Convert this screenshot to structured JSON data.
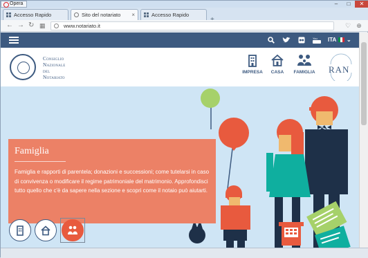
{
  "window": {
    "app_button": "Opera",
    "controls": [
      "–",
      "□",
      "✕"
    ]
  },
  "tabs": [
    {
      "label": "Accesso Rapido",
      "icon": "speed-dial-icon",
      "active": false
    },
    {
      "label": "Sito del notariato",
      "icon": "site-icon",
      "active": true
    },
    {
      "label": "Accesso Rapido",
      "icon": "speed-dial-icon",
      "active": false
    }
  ],
  "addressbar": {
    "url": "www.notariato.it"
  },
  "topbar": {
    "icons": [
      "search-icon",
      "twitter-icon",
      "flickr-icon",
      "youtube-icon"
    ],
    "language": "ITA",
    "language_caret": "⌄",
    "flag_colors": [
      "#009246",
      "#ffffff",
      "#ce2b37"
    ]
  },
  "header": {
    "org_line1": "Consiglio",
    "org_line2": "Nazionale",
    "org_line3": "del",
    "org_line4": "Notariato",
    "nav": [
      {
        "label": "IMPRESA",
        "icon": "building-icon"
      },
      {
        "label": "CASA",
        "icon": "house-icon"
      },
      {
        "label": "FAMIGLIA",
        "icon": "family-icon"
      }
    ],
    "ran_text": "RAN",
    "ran_arc": "RETE ASTE NOTARILI"
  },
  "hero": {
    "title": "Famiglia",
    "body": "Famiglia e rapporti di parentela; donazioni e successioni; come tutelarsi in caso di convivenza o modificare il regime patrimoniale del matrimonio. Approfondisci tutto quello che c'è da sapere nella sezione e scopri come il notaio può aiutarti.",
    "selectors": [
      {
        "icon": "building-icon",
        "active": false
      },
      {
        "icon": "house-icon",
        "active": false
      },
      {
        "icon": "family-icon",
        "active": true
      }
    ],
    "colors": {
      "card": "#ec8166",
      "navy": "#1e3048",
      "teal": "#0faf9f",
      "coral": "#e85a3e",
      "bg": "#cfe5f5"
    }
  }
}
